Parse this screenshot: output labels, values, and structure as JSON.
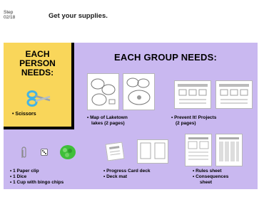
{
  "header": {
    "step_label": "Step",
    "step_number": "02/18",
    "title": "Get your supplies."
  },
  "person": {
    "heading": [
      "EACH",
      "PERSON",
      "NEEDS:"
    ],
    "item": "• Scissors"
  },
  "group": {
    "heading": "EACH GROUP NEEDS:",
    "map_label": [
      "• Map of Laketown",
      "lakes (2 pages)"
    ],
    "prevent_label": [
      "• Prevent It! Projects",
      "(2 pages)"
    ],
    "small_items": [
      "• 1 Paper clip",
      "• 1 Dice",
      "• 1 Cup with bingo chips"
    ],
    "card_items": [
      "• Progress Card deck",
      "• Deck mat"
    ],
    "rules_items": [
      "• Rules sheet",
      "• Consequences",
      "sheet"
    ]
  },
  "colors": {
    "panel": "#c9b8f0",
    "person_box": "#f9d65a",
    "scissors": "#42b4e6",
    "chips": "#3fbf3a"
  },
  "icons": [
    "scissors-icon",
    "paper-clip-icon",
    "dice-icon",
    "bingo-chips-icon"
  ]
}
